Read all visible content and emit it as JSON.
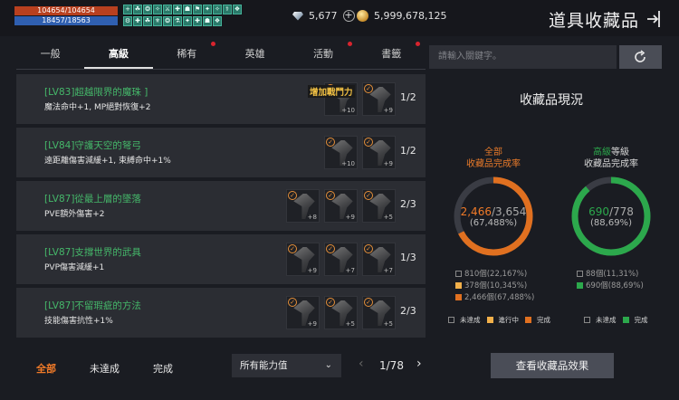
{
  "hp": {
    "text": "104654/104654"
  },
  "mp": {
    "text": "18457/18563"
  },
  "buffs": [
    "+",
    "☘",
    "❂",
    "✧",
    "⚔",
    "✚",
    "☗",
    "⚑",
    "✦",
    "✧",
    "⚕",
    "❖",
    "⚙",
    "✚",
    "☘",
    "⚜",
    "❂",
    "⚗",
    "✦",
    "✚",
    "☗",
    "❖"
  ],
  "currency": {
    "diamond": "5,677",
    "gold": "5,999,678,125"
  },
  "title": "道具收藏品",
  "tabs": [
    {
      "label": "一般",
      "active": false,
      "dot": false
    },
    {
      "label": "高級",
      "active": true,
      "dot": false
    },
    {
      "label": "稀有",
      "active": false,
      "dot": true
    },
    {
      "label": "英雄",
      "active": false,
      "dot": false
    },
    {
      "label": "活動",
      "active": false,
      "dot": true
    },
    {
      "label": "書籤",
      "active": false,
      "dot": true
    }
  ],
  "search": {
    "placeholder": "請輸入關鍵字。"
  },
  "collections": [
    {
      "name": "[LV83]超越限界的魔珠 ]",
      "desc": "魔法命中+1, MP絕對恢復+2",
      "count": "1/2",
      "boost": "增加戰鬥力",
      "items": [
        "+10",
        "+9"
      ]
    },
    {
      "name": "[LV84]守護天空的弩弓",
      "desc": "遠距離傷害減緩+1, 束縛命中+1%",
      "count": "1/2",
      "boost": "",
      "items": [
        "+10",
        "+9"
      ]
    },
    {
      "name": "[LV87]從最上層的墜落",
      "desc": "PVE額外傷害+2",
      "count": "2/3",
      "boost": "",
      "items": [
        "+8",
        "+9",
        "+5"
      ]
    },
    {
      "name": "[LV87]支撐世界的武具",
      "desc": "PVP傷害減緩+1",
      "count": "1/3",
      "boost": "",
      "items": [
        "+9",
        "+7",
        "+7"
      ]
    },
    {
      "name": "[LV87]不留瑕疵的方法",
      "desc": "技能傷害抗性+1%",
      "count": "2/3",
      "boost": "",
      "items": [
        "+9",
        "+5",
        "+5"
      ]
    }
  ],
  "filters": {
    "all": "全部",
    "incomplete": "未達成",
    "complete": "完成"
  },
  "dropdown": {
    "label": "所有能力值"
  },
  "pager": {
    "text": "1/78"
  },
  "stats": {
    "title": "收藏品現況",
    "all": {
      "label1": "全部",
      "label2": "收藏品完成率",
      "current": "2,466",
      "total": "/3,654",
      "percent": "(67,488%)",
      "percent_value": 67.488,
      "legend": [
        "810個(22,167%)",
        "378個(10,345%)",
        "2,466個(67,488%)"
      ],
      "keys": [
        "未達成",
        "進行中",
        "完成"
      ]
    },
    "advanced": {
      "label1": "高級",
      "label1b": "等級",
      "label2": "收藏品完成率",
      "current": "690",
      "total": "/778",
      "percent": "(88,69%)",
      "percent_value": 88.69,
      "legend": [
        "88個(11,31%)",
        "690個(88,69%)"
      ],
      "keys": [
        "未達成",
        "完成"
      ]
    }
  },
  "view_button": "查看收藏品效果",
  "colors": {
    "orange": "#e07020",
    "green": "#2ca84c",
    "gold": "#f2c144"
  }
}
